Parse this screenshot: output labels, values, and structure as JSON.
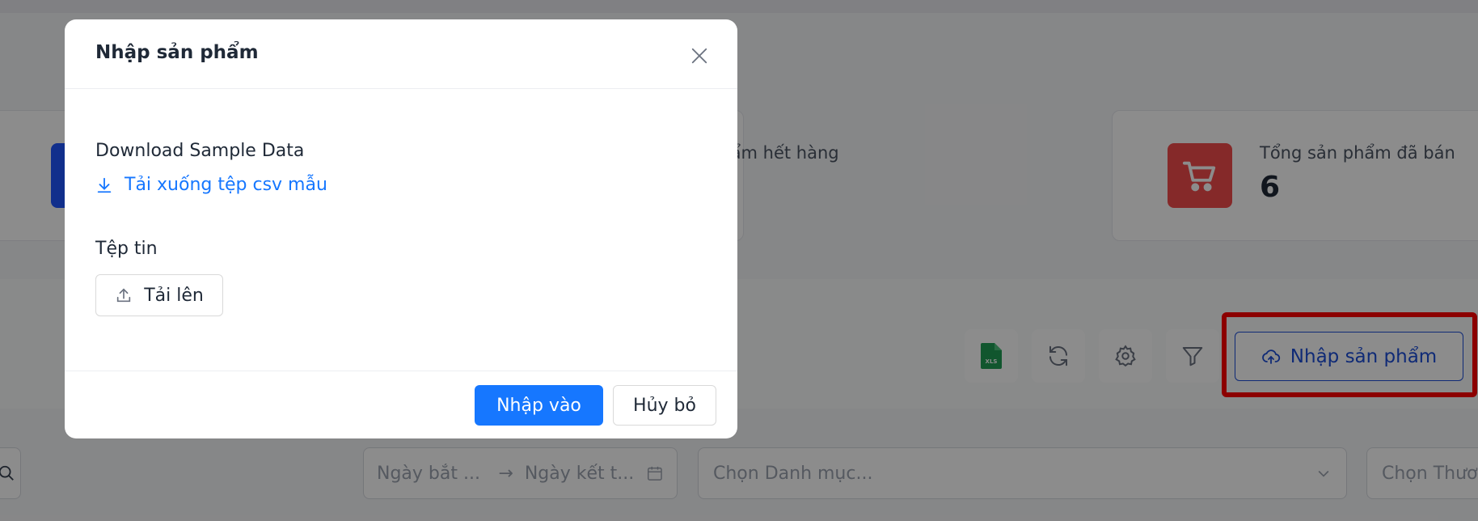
{
  "background": {
    "stats": [
      {
        "label": "phẩm hết hàng",
        "icon": "box-icon"
      },
      {
        "label": "Tổng sản phẩm đã bán",
        "value": "6",
        "icon": "shopping-cart-icon"
      }
    ],
    "toolbar": {
      "tools": [
        "excel-export-icon",
        "refresh-icon",
        "gear-icon",
        "filter-icon"
      ],
      "import_label": "Nhập sản phẩm"
    },
    "filters": {
      "start_date_placeholder": "Ngày bắt ...",
      "end_date_placeholder": "Ngày kết t...",
      "category_placeholder": "Chọn Danh mục...",
      "brand_placeholder": "Chọn Thươ"
    },
    "colors": {
      "primary": "#1677ff",
      "danger": "#f24b4b",
      "highlight": "#ff0000",
      "excel": "#1f9d55"
    }
  },
  "modal": {
    "title": "Nhập sản phẩm",
    "sample_section_label": "Download Sample Data",
    "download_link_label": "Tải xuống tệp csv mẫu",
    "file_section_label": "Tệp tin",
    "upload_label": "Tải lên",
    "submit_label": "Nhập vào",
    "cancel_label": "Hủy bỏ"
  }
}
